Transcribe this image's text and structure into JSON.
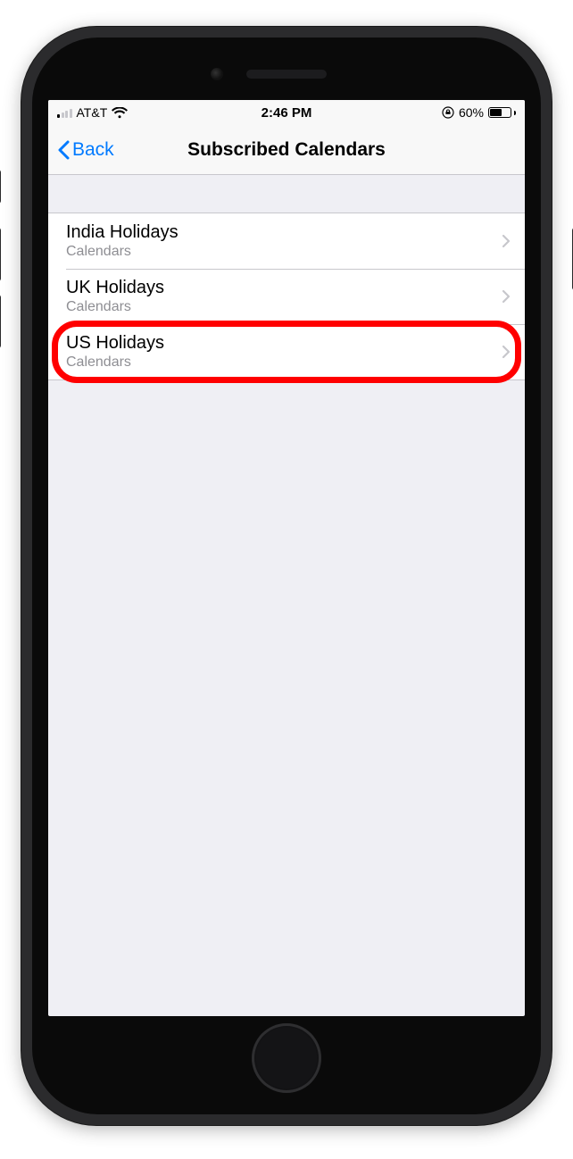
{
  "status": {
    "carrier": "AT&T",
    "time": "2:46 PM",
    "battery_pct": "60%"
  },
  "nav": {
    "back_label": "Back",
    "title": "Subscribed Calendars"
  },
  "calendars": [
    {
      "title": "India Holidays",
      "subtitle": "Calendars"
    },
    {
      "title": "UK Holidays",
      "subtitle": "Calendars"
    },
    {
      "title": "US Holidays",
      "subtitle": "Calendars"
    }
  ],
  "highlighted_index": 2
}
